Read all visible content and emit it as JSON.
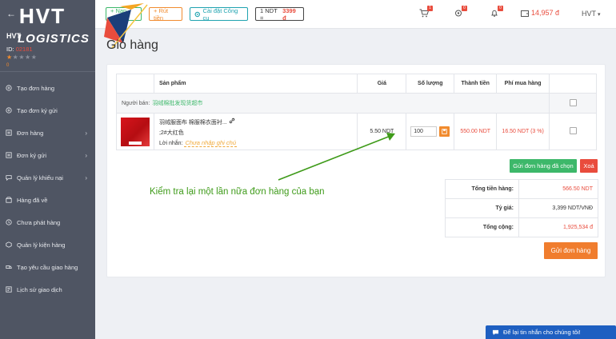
{
  "brand": {
    "name": "HVT",
    "sub": "LOGISTICS"
  },
  "sidebar": {
    "user_name": "HVT",
    "user_id_label": "ID:",
    "user_id": "02181",
    "score": "0",
    "rating": 1,
    "items": [
      {
        "label": "Tạo đơn hàng",
        "icon": "plus-circle-icon"
      },
      {
        "label": "Tạo đơn ký gửi",
        "icon": "plus-circle-icon"
      },
      {
        "label": "Đơn hàng",
        "icon": "list-icon",
        "expandable": true
      },
      {
        "label": "Đơn ký gửi",
        "icon": "list-icon",
        "expandable": true
      },
      {
        "label": "Quản lý khiếu nại",
        "icon": "comment-icon",
        "expandable": true
      },
      {
        "label": "Hàng đã về",
        "icon": "box-icon"
      },
      {
        "label": "Chưa phát hàng",
        "icon": "clock-icon"
      },
      {
        "label": "Quản lý kiện hàng",
        "icon": "package-icon"
      },
      {
        "label": "Tạo yêu cầu giao hàng",
        "icon": "truck-icon"
      },
      {
        "label": "Lịch sử giao dịch",
        "icon": "history-icon"
      }
    ]
  },
  "topbar": {
    "create_label": "+ Nạp tiền",
    "withdraw_label": "+ Rút tiền",
    "tools_label": "Cài đặt Công cụ",
    "rate_prefix": "1 NDT =",
    "rate_value": "3399 đ",
    "cart_count": "1",
    "settings_count": "0",
    "notif_count": "0",
    "balance": "14,957 đ",
    "user": "HVT"
  },
  "page": {
    "title": "Giỏ hàng"
  },
  "cart": {
    "headers": [
      "Sản phẩm",
      "Giá",
      "Số lượng",
      "Thành tiền",
      "Phí mua hàng"
    ],
    "seller_label": "Người bán:",
    "seller_name": "羽绒棉批发现货超市",
    "item": {
      "name": "羽绒服面布 棉服棉衣面衬...",
      "variant": ";2#大红色",
      "note_label": "Lời nhắn:",
      "note_placeholder": "Chưa nhập ghi chú",
      "price": "5.50 NDT",
      "quantity": "100",
      "total": "550.00 NDT",
      "fee": "16.50 NDT (3 %)"
    }
  },
  "actions": {
    "send_selected": "Gửi đơn hàng đã chọn",
    "delete": "Xoá",
    "submit": "Gửi đơn hàng"
  },
  "annotation": "Kiểm tra lại một lần nữa đơn hàng của bạn",
  "summary": {
    "rows": [
      {
        "label": "Tổng tiền hàng:",
        "value": "566.50 NDT"
      },
      {
        "label": "Tỷ giá:",
        "value": "3,399 NDT/VNĐ"
      },
      {
        "label": "Tổng cộng:",
        "value": "1,925,534 đ"
      }
    ]
  },
  "chat": {
    "label": "Để lại tin nhắn cho chúng tôi!"
  },
  "colors": {
    "sidebar": "#4f5563",
    "green": "#3db86a",
    "orange": "#f18b2e",
    "red": "#e94c3d",
    "teal": "#1fa3b0",
    "blue": "#1e5fc1"
  }
}
